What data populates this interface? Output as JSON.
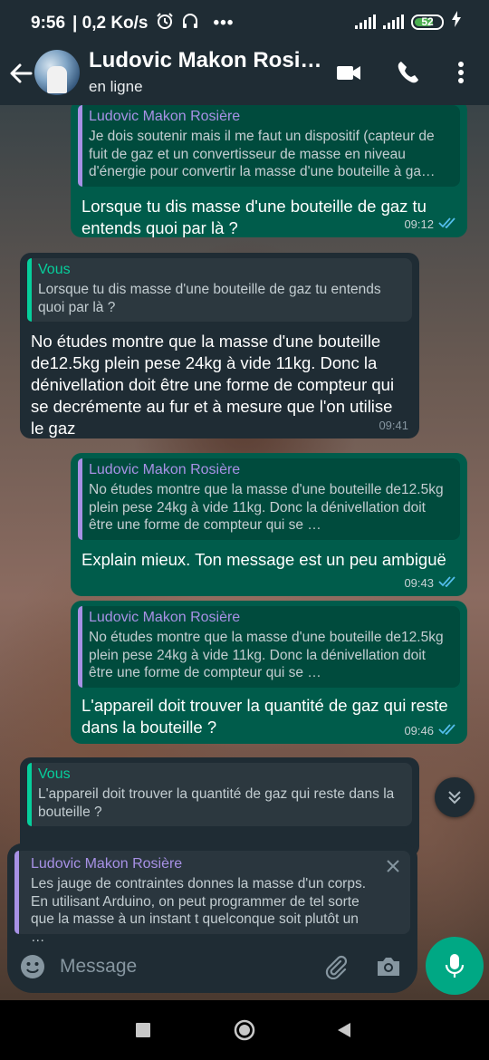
{
  "status_bar": {
    "time": "9:56",
    "speed": "| 0,2 Ko/s",
    "more": "•••",
    "battery": "52"
  },
  "header": {
    "contact_name": "Ludovic Makon Rosi…",
    "status": "en ligne"
  },
  "messages": [
    {
      "direction": "out",
      "quote_author": "Ludovic Makon Rosière",
      "quote_text": "Je dois soutenir mais il me faut un dispositif (capteur de fuit de gaz et un convertisseur de masse en niveau d'énergie pour convertir la masse d'une bouteille à ga…",
      "text": "Lorsque tu dis masse d'une bouteille de gaz tu entends quoi par là ?",
      "time": "09:12"
    },
    {
      "direction": "in",
      "quote_author": "Vous",
      "quote_text": "Lorsque tu dis masse d'une bouteille de gaz tu entends quoi par là ?",
      "text": "No études montre que la masse d'une bouteille de12.5kg plein pese 24kg à vide 11kg. Donc la dénivellation doit être une forme de compteur qui se decrémente au fur et à mesure que l'on utilise le gaz",
      "time": "09:41"
    },
    {
      "direction": "out",
      "quote_author": "Ludovic Makon Rosière",
      "quote_text": "No études montre que la masse d'une bouteille de12.5kg plein pese 24kg à vide 11kg. Donc la dénivellation doit être une forme de compteur qui se …",
      "text": "Explain mieux. Ton message est un peu ambiguë",
      "time": "09:43"
    },
    {
      "direction": "out",
      "quote_author": "Ludovic Makon Rosière",
      "quote_text": "No études montre que la masse d'une bouteille de12.5kg plein pese 24kg à vide 11kg. Donc la dénivellation doit être une forme de compteur qui se …",
      "text": "L'appareil doit trouver la quantité de gaz qui reste dans la bouteille ?",
      "time": "09:46"
    },
    {
      "direction": "in",
      "quote_author": "Vous",
      "quote_text": "L'appareil doit trouver la quantité de gaz qui reste dans la bouteille ?"
    }
  ],
  "reply": {
    "author": "Ludovic Makon Rosière",
    "text": "Les jauge de contraintes donnes la masse d'un corps. En utilisant Arduino, on peut programmer de tel sorte que la masse à un instant t quelconque soit plutôt un …"
  },
  "input": {
    "placeholder": "Message"
  },
  "colors": {
    "outgoing_bubble": "#005c4b",
    "incoming_bubble": "#1f2c34",
    "accent": "#00a884",
    "read_ticks": "#53bdeb",
    "quote_author_other": "#a791e5",
    "quote_author_self": "#06cf9c"
  }
}
